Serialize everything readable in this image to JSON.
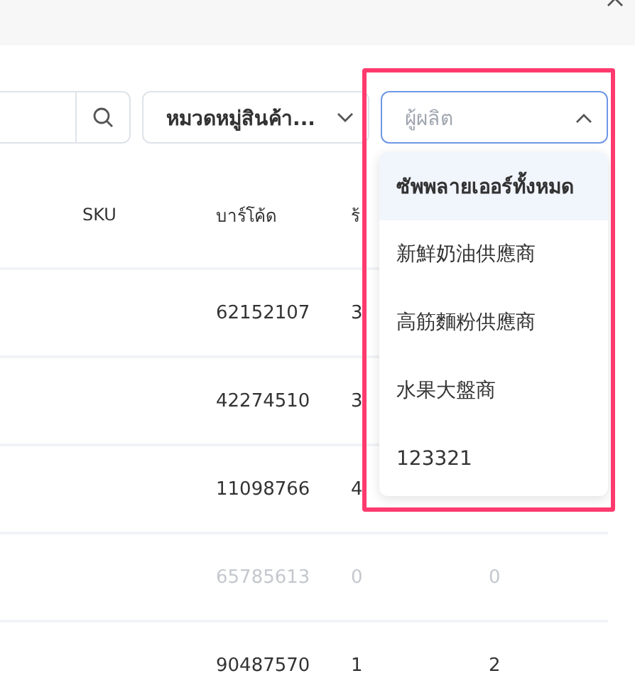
{
  "toolbar": {
    "category_select": {
      "value": "หมวดหมู่สินค้า...",
      "expanded": false
    },
    "supplier_select": {
      "placeholder": "ผู้ผลิต",
      "expanded": true
    }
  },
  "table": {
    "columns": [
      "SKU",
      "บาร์โค้ด",
      "ร้"
    ],
    "rows": [
      {
        "barcode": "62152107",
        "store": "3",
        "disabled": false
      },
      {
        "barcode": "42274510",
        "store": "3",
        "disabled": false
      },
      {
        "barcode": "11098766",
        "store": "4",
        "disabled": false
      },
      {
        "barcode": "65785613",
        "store": "0",
        "column_4": "0",
        "disabled": true
      },
      {
        "barcode": "90487570",
        "store": "1",
        "column_4": "2",
        "disabled": false
      }
    ]
  },
  "supplier_menu": {
    "items": [
      {
        "label": "ซัพพลายเออร์ทั้งหมด",
        "selected": true
      },
      {
        "label": "新鮮奶油供應商",
        "selected": false
      },
      {
        "label": "高筋麵粉供應商",
        "selected": false
      },
      {
        "label": "水果大盤商",
        "selected": false
      },
      {
        "label": "123321",
        "selected": false
      }
    ]
  }
}
